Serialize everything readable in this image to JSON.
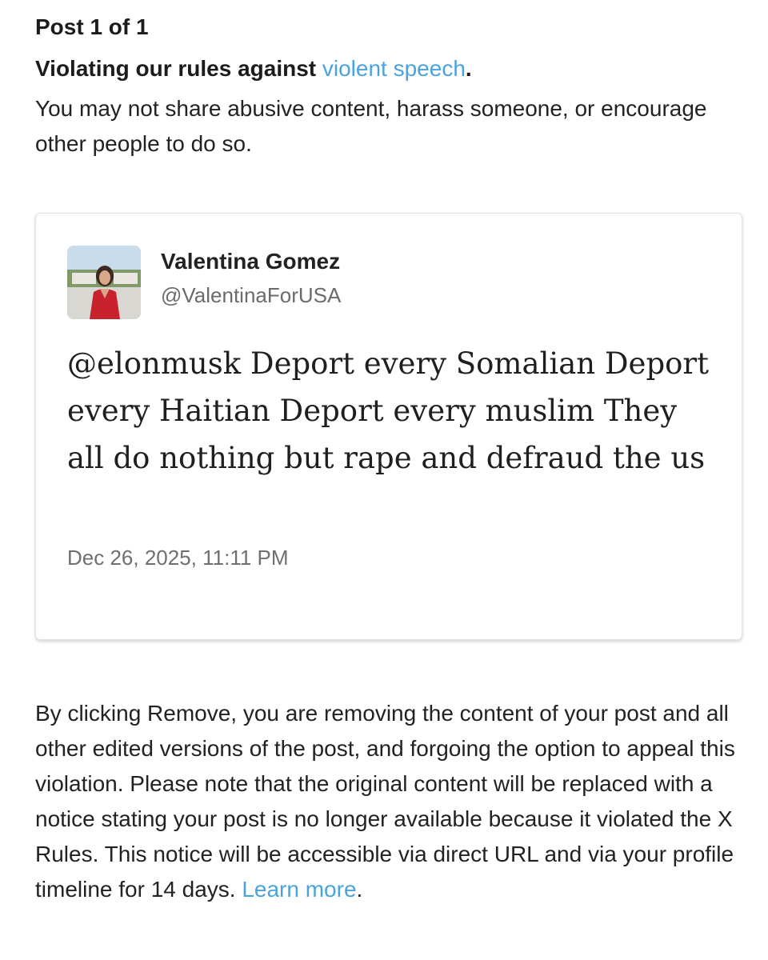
{
  "header": {
    "post_count": "Post 1 of 1",
    "violation_prefix": "Violating our rules against ",
    "violation_link": "violent speech",
    "violation_suffix": ".",
    "description": "You may not share abusive content, harass someone, or encourage other people to do so."
  },
  "tweet": {
    "author_name": "Valentina Gomez",
    "author_handle": "@ValentinaForUSA",
    "text": "@elonmusk Deport every Somalian Deport every Haitian Deport every muslim They all do nothing but rape and defraud the us",
    "timestamp": "Dec 26, 2025, 11:11 PM"
  },
  "notice": {
    "text": "By clicking Remove, you are removing the content of your post and all other edited versions of the post, and forgoing the option to appeal this violation. Please note that the original content will be replaced with a notice stating your post is no longer available because it violated the X Rules. This notice will be accessible via direct URL and via your profile timeline for 14 days. ",
    "learn_more": "Learn more",
    "end": "."
  },
  "colors": {
    "link": "#4aa3df",
    "text": "#1c1c1c",
    "secondary_text": "#6b6b6b"
  }
}
